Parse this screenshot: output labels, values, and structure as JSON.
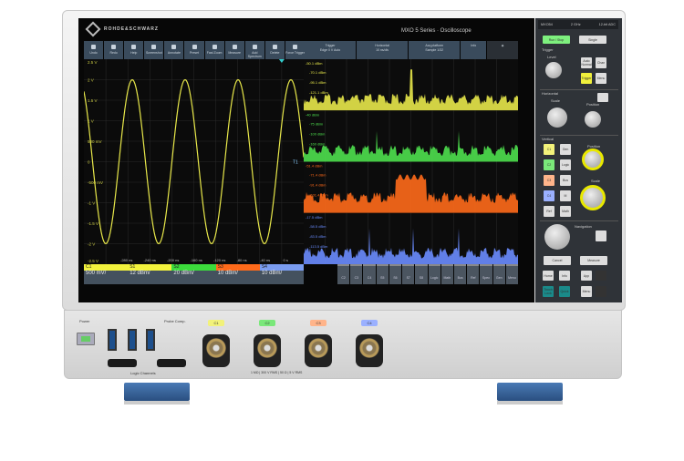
{
  "brand": "ROHDE&SCHWARZ",
  "series_title": "MXO 5 Series · Oscilloscope",
  "toolbar": [
    "Undo",
    "Redo",
    "Help",
    "Screenshot",
    "Annotate",
    "Preset",
    "Fast Zoom",
    "Measure",
    "Add Spectrum",
    "Delete",
    "Force Trigger"
  ],
  "top_groups": [
    {
      "label": "Trigger",
      "sub": "Edge  0 V  Auto"
    },
    {
      "label": "Horizontal",
      "sub": "10 ns/div"
    },
    {
      "label": "Acq platform",
      "sub": "Sample  1/32"
    },
    {
      "label": "Info",
      "sub": ""
    }
  ],
  "tab_label": "Tab 1",
  "waveform": {
    "color": "#e8e84a",
    "y_labels": [
      "2.5 V",
      "2 V",
      "1.5 V",
      "1 V",
      "500 mV",
      "0",
      "-500 mV",
      "-1 V",
      "-1.5 V",
      "-2 V",
      "-2.5 V"
    ],
    "x_labels": [
      "-280 ns",
      "-240 ns",
      "-200 ns",
      "-160 ns",
      "-120 ns",
      "-80 ns",
      "-40 ns",
      "0 s",
      "40 ns"
    ],
    "trigger_marker": "T1"
  },
  "spectra": [
    {
      "color": "#e8e84a",
      "top": "-50.1 dBm",
      "labels": [
        "-70.1 dBm",
        "-95.1 dBm",
        "-121.1 dBm"
      ]
    },
    {
      "color": "#4ee04e",
      "top": "-40 dBm",
      "labels": [
        "-75 dBm",
        "-100 dBm",
        "-160 dBm"
      ]
    },
    {
      "color": "#ff6a1a",
      "top": "-51.4 dBm",
      "labels": [
        "-71.4 dBm",
        "-91.4 dBm",
        "-101.4 dBm"
      ]
    },
    {
      "color": "#6a8cff",
      "top": "-17.5 dBm",
      "labels": [
        "-58.5 dBm",
        "-83.5 dBm",
        "-113.5 dBm"
      ]
    }
  ],
  "channels": [
    {
      "name": "C1",
      "value": "500 mV/",
      "color": "#f2f23c"
    },
    {
      "name": "S1",
      "value": "12 dBm/",
      "color": "#f2f23c"
    },
    {
      "name": "S2",
      "value": "20 dBm/",
      "color": "#3cdc3c"
    },
    {
      "name": "S3",
      "value": "10 dBm/",
      "color": "#ff6a1a"
    },
    {
      "name": "S4",
      "value": "10 dBm/",
      "color": "#7a9cf0"
    }
  ],
  "bottom_buttons": [
    "C2",
    "C3",
    "C4",
    "S5",
    "S6",
    "S7",
    "S8",
    "Logic",
    "Math",
    "Bus",
    "Ref",
    "Spec",
    "Gen",
    "Menu"
  ],
  "panel": {
    "model": "MXO54",
    "bandwidth": "2 GHz",
    "adc": "12-bit ADC",
    "run_stop": "Run / Stop",
    "single": "Single",
    "trigger": "Trigger",
    "level": "Level",
    "auto_normal": "Auto Normal",
    "trig": "Trigger",
    "chan": "Chan",
    "horizontal": "Horizontal",
    "scale": "Scale",
    "position": "Position",
    "vertical": "Vertical",
    "ch": [
      "C1",
      "C2",
      "C3",
      "C4"
    ],
    "ref": "Ref",
    "gen": "Gen",
    "logic": "Logic",
    "bus": "Bus",
    "m": "M",
    "math": "Math",
    "v_position": "Position",
    "v_scale": "Scale",
    "navigation": "Navigation",
    "cancel": "Cancel",
    "measure": "Measure",
    "home": "Home",
    "info": "Info",
    "touch_lock": "Touch Lock",
    "app": "App",
    "quick": "Quick",
    "menu": "Menu"
  },
  "front": {
    "power": "Power",
    "probe_comp": "Probe Comp.",
    "logic_channels": "Logic Channels",
    "inputs": [
      "C1",
      "C2",
      "C3",
      "C4"
    ],
    "input_colors": [
      "#f2f27a",
      "#7ae87a",
      "#ffb48a",
      "#9ab0ff"
    ],
    "warning": "1 MΩ | 300 V RMS | 50 Ω | 5 V RMS"
  }
}
